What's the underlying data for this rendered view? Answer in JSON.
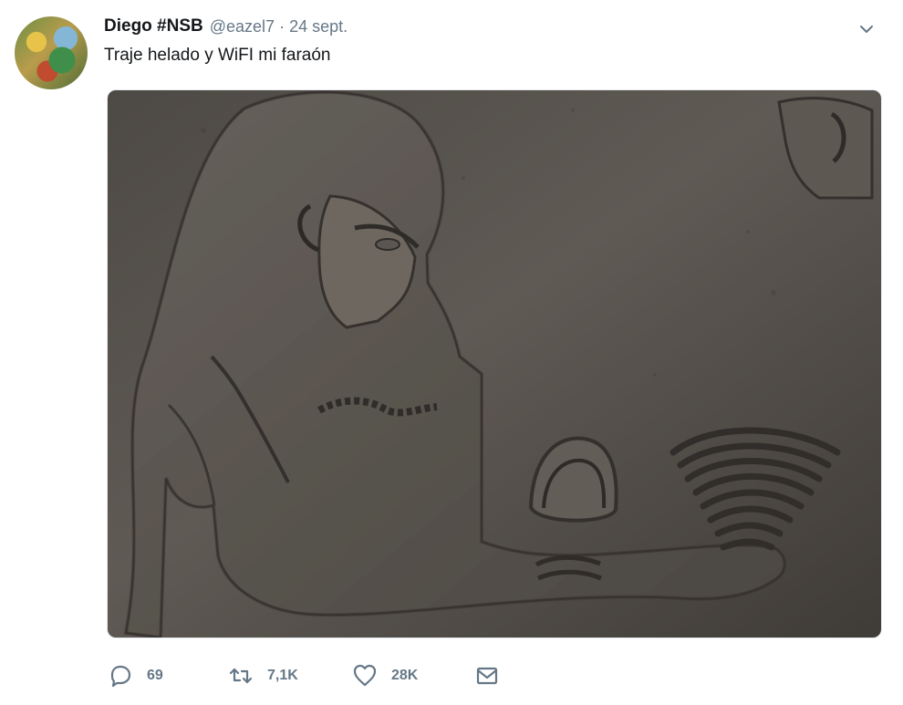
{
  "tweet": {
    "author": {
      "name": "Diego #NSB",
      "handle": "@eazel7",
      "separator": "·",
      "date": "24 sept."
    },
    "text": "Traje helado y WiFI mi faraón",
    "media": {
      "icon": "egyptian-relief-photo"
    },
    "actions": {
      "replies": "69",
      "retweets": "7,1K",
      "likes": "28K"
    }
  },
  "icons": {
    "menu": "chevron-down-icon",
    "reply": "reply-icon",
    "retweet": "retweet-icon",
    "like": "heart-icon",
    "message": "mail-icon"
  },
  "colors": {
    "text": "#14171a",
    "muted": "#657786"
  }
}
